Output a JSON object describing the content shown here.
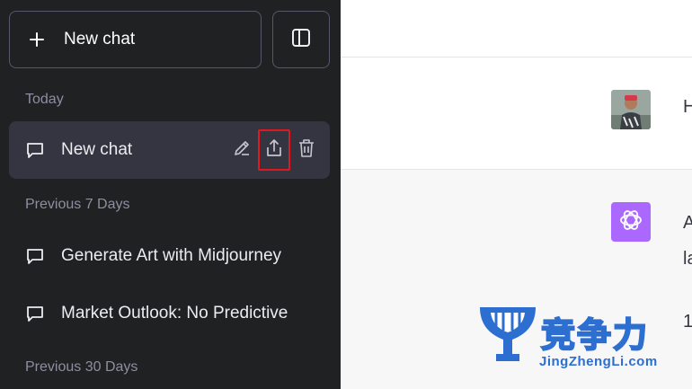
{
  "sidebar": {
    "new_chat_label": "New chat",
    "sections": {
      "today": "Today",
      "previous_7_days": "Previous 7 Days",
      "previous_30_days": "Previous 30 Days"
    },
    "chats": [
      {
        "title": "New chat",
        "active": true
      },
      {
        "title": "Generate Art with Midjourney",
        "active": false
      },
      {
        "title": "Market Outlook: No Predictive",
        "active": false
      }
    ]
  },
  "conversation": {
    "user_message_preview": "H",
    "assistant_message_line1": "A",
    "assistant_message_line2": "la",
    "assistant_message_line3": "1"
  },
  "watermark": {
    "chinese": "竞争力",
    "latin": "JingZhengLi.com"
  },
  "colors": {
    "sidebar_bg": "#202123",
    "active_item_bg": "#343541",
    "assistant_avatar": "#ab68ff",
    "highlight_box": "#e0191f",
    "watermark_blue": "#2c6fd1"
  },
  "icons": [
    "plus-icon",
    "sidebar-toggle-icon",
    "chat-bubble-icon",
    "pencil-icon",
    "share-icon",
    "trash-icon",
    "openai-logo-icon"
  ]
}
